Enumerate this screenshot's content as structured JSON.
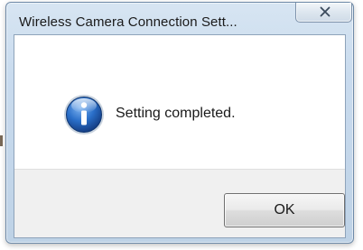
{
  "window": {
    "title": "Wireless Camera Connection Sett..."
  },
  "titlebar": {
    "close_icon": "close-icon"
  },
  "message": {
    "icon": "information-icon",
    "text": "Setting completed."
  },
  "buttons": {
    "ok_label": "OK"
  },
  "colors": {
    "frame": "#c9dbee",
    "content_bg": "#ffffff",
    "button_area_bg": "#f0f0f0",
    "info_icon_blue": "#1f5fb5"
  }
}
